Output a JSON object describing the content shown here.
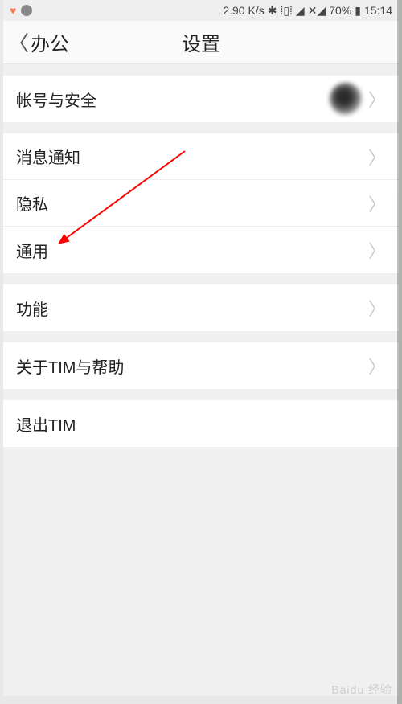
{
  "status": {
    "speed": "2.90 K/s",
    "battery": "70%",
    "time": "15:14"
  },
  "nav": {
    "back_label": "办公",
    "title": "设置"
  },
  "sections": {
    "account": {
      "label": "帐号与安全"
    },
    "notify": {
      "label": "消息通知"
    },
    "privacy": {
      "label": "隐私"
    },
    "general": {
      "label": "通用"
    },
    "features": {
      "label": "功能"
    },
    "about": {
      "label": "关于TIM与帮助"
    },
    "logout": {
      "label": "退出TIM"
    }
  },
  "watermark": "Baidu 经验"
}
